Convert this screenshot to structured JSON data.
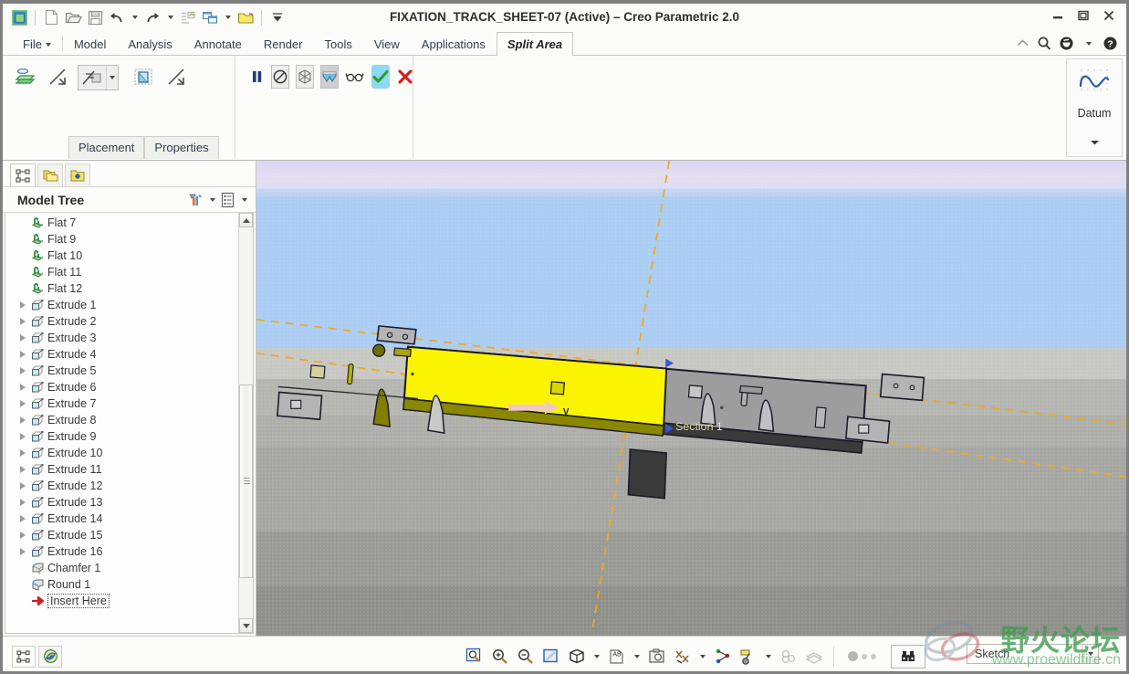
{
  "window": {
    "title": "FIXATION_TRACK_SHEET-07 (Active) – Creo Parametric 2.0",
    "minimize": "Minimize",
    "maximize": "Maximize",
    "close": "Close"
  },
  "quick_access": {
    "items": [
      {
        "name": "creo-logo-icon",
        "label": "Creo"
      },
      {
        "name": "new-icon",
        "label": "New"
      },
      {
        "name": "open-icon",
        "label": "Open"
      },
      {
        "name": "save-icon",
        "label": "Save"
      },
      {
        "name": "undo-icon",
        "label": "Undo"
      },
      {
        "name": "redo-icon",
        "label": "Redo"
      },
      {
        "name": "regenerate-icon",
        "label": "Regenerate"
      },
      {
        "name": "window-switch-icon",
        "label": "Window"
      },
      {
        "name": "close-window-icon",
        "label": "Close Window"
      }
    ],
    "overflow_label": "Customize Quick Access Toolbar"
  },
  "ribbon": {
    "tabs": [
      {
        "label": "File",
        "active": false,
        "has_caret": true
      },
      {
        "label": "Model",
        "active": false
      },
      {
        "label": "Analysis",
        "active": false
      },
      {
        "label": "Annotate",
        "active": false
      },
      {
        "label": "Render",
        "active": false
      },
      {
        "label": "Tools",
        "active": false
      },
      {
        "label": "View",
        "active": false
      },
      {
        "label": "Applications",
        "active": false
      },
      {
        "label": "Split Area",
        "active": true
      }
    ],
    "right_controls": [
      {
        "name": "collapse-ribbon-icon",
        "label": "Minimize the Ribbon"
      },
      {
        "name": "search-icon",
        "label": "Search"
      },
      {
        "name": "help-center-icon",
        "label": "Help Center"
      },
      {
        "name": "help-icon",
        "label": "Help"
      }
    ],
    "group_references": {
      "icons": [
        {
          "name": "split-surface-icon",
          "label": "Split Surface"
        },
        {
          "name": "flip-direction-1-icon",
          "label": "Flip Direction"
        },
        {
          "name": "split-type-combo-icon",
          "label": "Split Type"
        },
        {
          "name": "split-region-icon",
          "label": "Split Region"
        },
        {
          "name": "flip-direction-2-icon",
          "label": "Flip Direction"
        }
      ],
      "panel_tabs": [
        {
          "label": "Placement"
        },
        {
          "label": "Properties"
        }
      ]
    },
    "group_dashboard": {
      "icons": [
        {
          "name": "pause-icon",
          "label": "Pause"
        },
        {
          "name": "no-preview-icon",
          "label": "No Preview"
        },
        {
          "name": "wireframe-preview-icon",
          "label": "Wireframe Preview"
        },
        {
          "name": "shaded-preview-icon",
          "label": "Shaded Preview"
        },
        {
          "name": "glasses-preview-icon",
          "label": "Preview"
        },
        {
          "name": "accept-check-icon",
          "label": "OK"
        },
        {
          "name": "cancel-x-icon",
          "label": "Cancel"
        }
      ]
    },
    "group_datum": {
      "label": "Datum",
      "icon": "datum-curve-icon"
    }
  },
  "navigator": {
    "tabs": [
      {
        "name": "model-tree-tab",
        "label": "Model Tree",
        "active": true
      },
      {
        "name": "folder-browser-tab",
        "label": "Folder Browser",
        "active": false
      },
      {
        "name": "favorites-tab",
        "label": "Favorites",
        "active": false
      }
    ],
    "header": {
      "title": "Model Tree",
      "filter_icon": "filter-settings-icon",
      "display_icon": "tree-display-icon"
    },
    "tree": [
      {
        "label": "Flat 7",
        "icon": "flat-feature-icon",
        "expandable": false
      },
      {
        "label": "Flat 9",
        "icon": "flat-feature-icon",
        "expandable": false
      },
      {
        "label": "Flat 10",
        "icon": "flat-feature-icon",
        "expandable": false
      },
      {
        "label": "Flat 11",
        "icon": "flat-feature-icon",
        "expandable": false
      },
      {
        "label": "Flat 12",
        "icon": "flat-feature-icon",
        "expandable": false
      },
      {
        "label": "Extrude 1",
        "icon": "extrude-feature-icon",
        "expandable": true
      },
      {
        "label": "Extrude 2",
        "icon": "extrude-feature-icon",
        "expandable": true
      },
      {
        "label": "Extrude 3",
        "icon": "extrude-feature-icon",
        "expandable": true
      },
      {
        "label": "Extrude 4",
        "icon": "extrude-feature-icon",
        "expandable": true
      },
      {
        "label": "Extrude 5",
        "icon": "extrude-feature-icon",
        "expandable": true
      },
      {
        "label": "Extrude 6",
        "icon": "extrude-feature-icon",
        "expandable": true
      },
      {
        "label": "Extrude 7",
        "icon": "extrude-feature-icon",
        "expandable": true
      },
      {
        "label": "Extrude 8",
        "icon": "extrude-feature-icon",
        "expandable": true
      },
      {
        "label": "Extrude 9",
        "icon": "extrude-feature-icon",
        "expandable": true
      },
      {
        "label": "Extrude 10",
        "icon": "extrude-feature-icon",
        "expandable": true
      },
      {
        "label": "Extrude 11",
        "icon": "extrude-feature-icon",
        "expandable": true
      },
      {
        "label": "Extrude 12",
        "icon": "extrude-feature-icon",
        "expandable": true
      },
      {
        "label": "Extrude 13",
        "icon": "extrude-feature-icon",
        "expandable": true
      },
      {
        "label": "Extrude 14",
        "icon": "extrude-feature-icon",
        "expandable": true
      },
      {
        "label": "Extrude 15",
        "icon": "extrude-feature-icon",
        "expandable": true
      },
      {
        "label": "Extrude 16",
        "icon": "extrude-feature-icon",
        "expandable": true
      },
      {
        "label": "Chamfer 1",
        "icon": "chamfer-feature-icon",
        "expandable": false
      },
      {
        "label": "Round 1",
        "icon": "round-feature-icon",
        "expandable": false
      },
      {
        "label": "Insert Here",
        "icon": "insert-here-icon",
        "expandable": false,
        "insert": true
      }
    ]
  },
  "graphics": {
    "section_label": "Section 1",
    "axis_label": "V",
    "colors": {
      "sky_top": "#dcdcf6",
      "sky_pink": "#e8dcf0",
      "sky_blue": "#aaccf2",
      "ground_light": "#c6c6c2",
      "ground_mid": "#a9a9a6",
      "ground_dark": "#8e8e8c",
      "highlight_yellow": "#fbf400",
      "part_gray": "#a0a0a0",
      "datum_orange": "#f5a623",
      "arrow_pink": "#f0c9c2"
    }
  },
  "bottom_bar": {
    "left_tabs": [
      {
        "name": "model-tree-toggle",
        "label": "Show Navigator"
      },
      {
        "name": "browser-toggle",
        "label": "Show Web Browser"
      }
    ],
    "tools": [
      {
        "name": "zoom-box-icon",
        "label": "Zoom to Area"
      },
      {
        "name": "zoom-in-icon",
        "label": "Zoom In"
      },
      {
        "name": "zoom-out-icon",
        "label": "Zoom Out"
      },
      {
        "name": "refit-icon",
        "label": "Refit"
      },
      {
        "name": "display-style-icon",
        "label": "Display Style",
        "has_caret": true
      },
      {
        "name": "annotation-display-icon",
        "label": "Annotation Display",
        "has_caret": true
      },
      {
        "name": "saved-orientations-icon",
        "label": "Saved Orientations"
      },
      {
        "name": "datum-display-icon",
        "label": "Datum Display Filters",
        "has_caret": true
      },
      {
        "name": "point-display-icon",
        "label": "Point Display Filters"
      },
      {
        "name": "csys-display-icon",
        "label": "Coordinate System Display",
        "has_caret": true
      },
      {
        "name": "spin-center-icon",
        "label": "Spin Center"
      },
      {
        "name": "layer-display-icon",
        "label": "Layers"
      }
    ],
    "search_button": {
      "name": "search-binoculars-icon",
      "label": "Search"
    },
    "selection_filter": {
      "value": "Sketch",
      "placeholder": "Sketch"
    }
  },
  "watermark": {
    "forum": "野火论坛",
    "url": "www.proewildfire.cn"
  }
}
